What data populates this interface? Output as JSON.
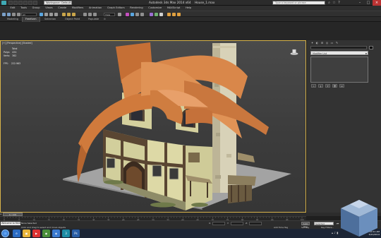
{
  "app": {
    "workspace": "Workspace: Default",
    "title": "Autodesk 3ds Max  2014 x64",
    "file": "House_1.max",
    "search_placeholder": "Type a keyword or phrase"
  },
  "menu": [
    "Edit",
    "Tools",
    "Group",
    "Views",
    "Create",
    "Modifiers",
    "Animation",
    "Graph Editors",
    "Rendering",
    "Customize",
    "MAXScript",
    "Help"
  ],
  "toolbar": {
    "selection_filter": "All",
    "reference_coord": "View"
  },
  "ribbon_tabs": [
    "Modeling",
    "Freeform",
    "Selection",
    "Object Paint",
    "Populate"
  ],
  "ribbon_active": 1,
  "viewport": {
    "label": "[+] [Perspective] [Shaded]",
    "stats": {
      "total_label": "Total",
      "polys_label": "Polys:",
      "polys_value": "434",
      "verts_label": "Verts:",
      "verts_value": "362",
      "fps_label": "FPS:",
      "fps_value": "222.963"
    }
  },
  "command_panel": {
    "modifier_list": "Modifier List"
  },
  "timeline": {
    "slider": "0 / 100",
    "ruler_ticks": [
      "0",
      "5",
      "10",
      "15",
      "20",
      "25",
      "30",
      "35",
      "40",
      "45",
      "50",
      "55",
      "60",
      "65",
      "70",
      "75",
      "80",
      "85",
      "90",
      "95",
      "100"
    ]
  },
  "status": {
    "welcome": "Welcome to MAX",
    "selection": "None Selected",
    "prompt": "Click and drag to select and move objects",
    "x_label": "X:",
    "y_label": "Y:",
    "z_label": "Z:",
    "auto_key": "Auto Key",
    "selected": "Selected",
    "set_key": "Set Key",
    "key_filters": "Key Filters...",
    "add_time_tag": "Add Time Tag"
  },
  "taskbar": {
    "time": "10:11 AM",
    "date": "5/21/2014"
  },
  "colors": {
    "viewport_border": "#d8b34a",
    "roof": "#d9874a",
    "background": "#1f1f1f"
  }
}
